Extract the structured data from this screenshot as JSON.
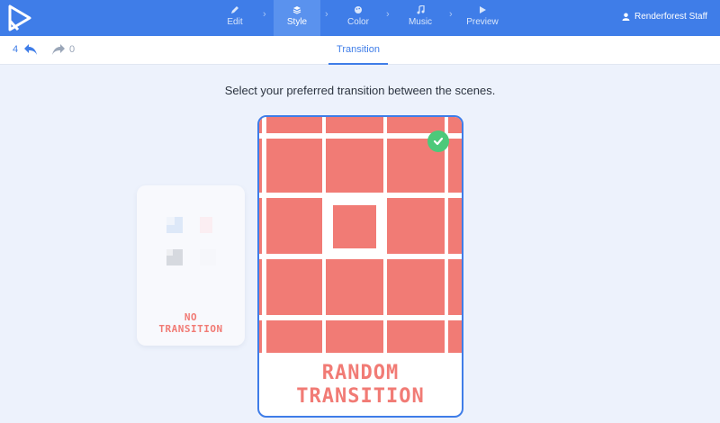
{
  "nav": {
    "steps": [
      {
        "label": "Edit",
        "icon": "pencil-icon"
      },
      {
        "label": "Style",
        "icon": "layers-icon"
      },
      {
        "label": "Color",
        "icon": "palette-icon"
      },
      {
        "label": "Music",
        "icon": "music-note-icon"
      },
      {
        "label": "Preview",
        "icon": "play-icon"
      }
    ],
    "user": "Renderforest Staff"
  },
  "history": {
    "undo_count": "4",
    "redo_count": "0"
  },
  "tabs": {
    "active": "Transition"
  },
  "main": {
    "heading": "Select your preferred transition between the scenes.",
    "options": [
      {
        "label_line1": "NO",
        "label_line2": "TRANSITION",
        "selected": false
      },
      {
        "label_line1": "RANDOM",
        "label_line2": "TRANSITION",
        "selected": true
      }
    ]
  },
  "colors": {
    "brand_blue": "#3f7de8",
    "accent_coral": "#f17b75",
    "check_green": "#4cc97a"
  }
}
